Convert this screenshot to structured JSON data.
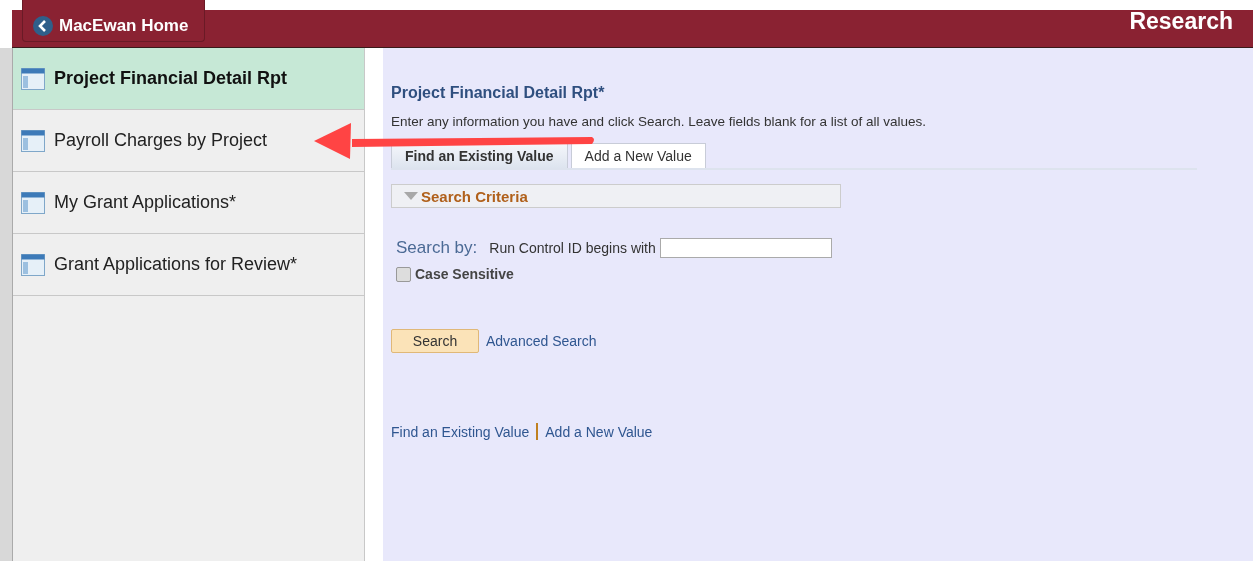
{
  "header": {
    "back_button": "MacEwan Home",
    "title": "Research"
  },
  "sidebar": {
    "items": [
      {
        "label": "Project Financial Detail Rpt",
        "selected": true
      },
      {
        "label": "Payroll Charges by Project",
        "selected": false
      },
      {
        "label": "My Grant Applications*",
        "selected": false
      },
      {
        "label": "Grant Applications for Review*",
        "selected": false
      }
    ]
  },
  "content": {
    "title": "Project Financial Detail Rpt*",
    "instructions": "Enter any information you have and click Search. Leave fields blank for a list of all values.",
    "tabs": [
      {
        "label": "Find an Existing Value",
        "selected": true
      },
      {
        "label": "Add a New Value",
        "selected": false
      }
    ],
    "section": {
      "label": "Search Criteria",
      "expanded": true
    },
    "search_by": "Search by:",
    "field_label": "Run Control ID begins with",
    "case_sensitive": {
      "label": "Case Sensitive",
      "checked": false
    },
    "search_button": "Search",
    "advanced_search": "Advanced Search",
    "footer_links": [
      "Find an Existing Value",
      "Add a New Value"
    ]
  },
  "annotation": {
    "kind": "arrow"
  }
}
